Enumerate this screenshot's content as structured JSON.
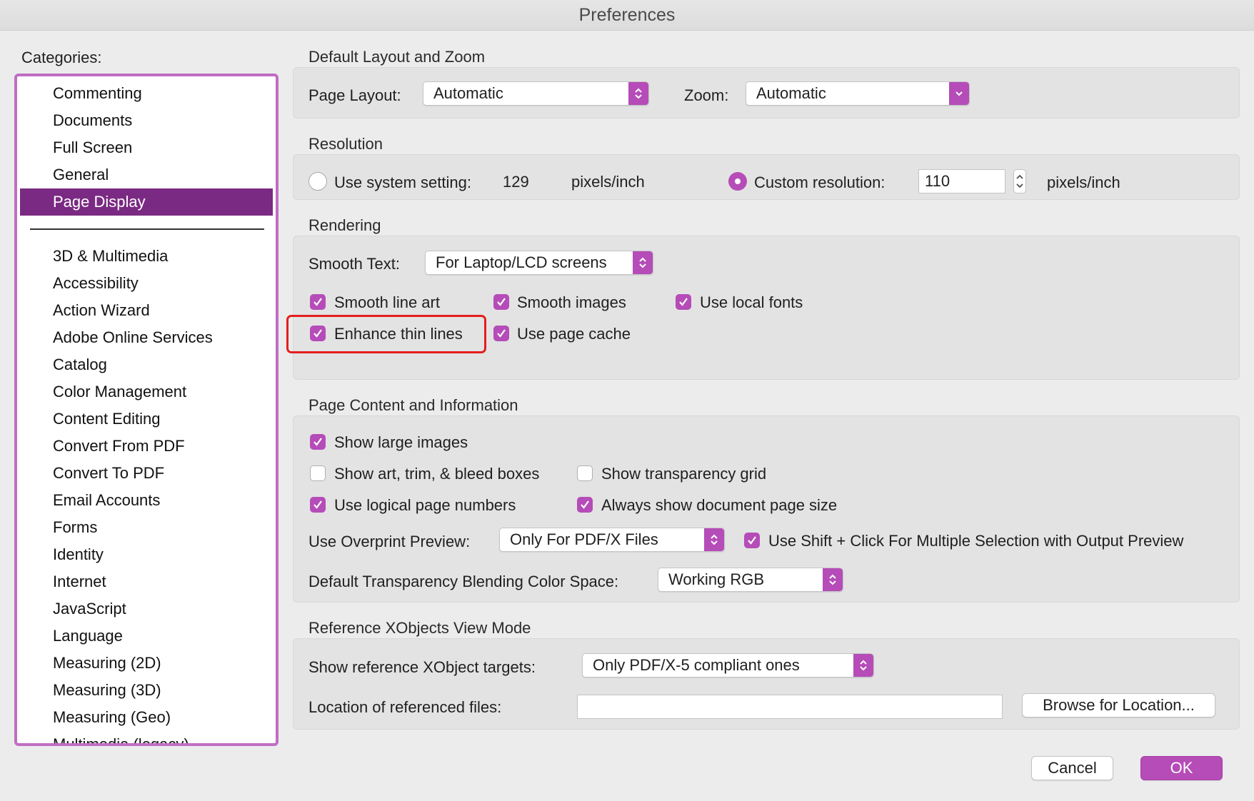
{
  "window": {
    "title": "Preferences"
  },
  "sidebar": {
    "label": "Categories:",
    "top_items": [
      "Commenting",
      "Documents",
      "Full Screen",
      "General",
      "Page Display"
    ],
    "selected": "Page Display",
    "items": [
      "3D & Multimedia",
      "Accessibility",
      "Action Wizard",
      "Adobe Online Services",
      "Catalog",
      "Color Management",
      "Content Editing",
      "Convert From PDF",
      "Convert To PDF",
      "Email Accounts",
      "Forms",
      "Identity",
      "Internet",
      "JavaScript",
      "Language",
      "Measuring (2D)",
      "Measuring (3D)",
      "Measuring (Geo)",
      "Multimedia (legacy)"
    ]
  },
  "layout_zoom": {
    "heading": "Default Layout and Zoom",
    "page_layout_label": "Page Layout:",
    "page_layout_value": "Automatic",
    "zoom_label": "Zoom:",
    "zoom_value": "Automatic"
  },
  "resolution": {
    "heading": "Resolution",
    "system_label": "Use system setting:",
    "system_value": "129",
    "unit": "pixels/inch",
    "custom_label": "Custom resolution:",
    "custom_value": "110",
    "system_selected": false,
    "custom_selected": true
  },
  "rendering": {
    "heading": "Rendering",
    "smooth_text_label": "Smooth Text:",
    "smooth_text_value": "For Laptop/LCD screens",
    "smooth_line_art": "Smooth line art",
    "smooth_images": "Smooth images",
    "use_local_fonts": "Use local fonts",
    "enhance_thin_lines": "Enhance thin lines",
    "use_page_cache": "Use page cache"
  },
  "page_content": {
    "heading": "Page Content and Information",
    "show_large_images": "Show large images",
    "show_art_boxes": "Show art, trim, & bleed boxes",
    "show_transparency_grid": "Show transparency grid",
    "use_logical_page_numbers": "Use logical page numbers",
    "always_show_page_size": "Always show document page size",
    "overprint_label": "Use Overprint Preview:",
    "overprint_value": "Only For PDF/X Files",
    "shift_click": "Use Shift + Click For Multiple Selection with Output Preview",
    "blending_label": "Default Transparency Blending Color Space:",
    "blending_value": "Working RGB"
  },
  "xobjects": {
    "heading": "Reference XObjects View Mode",
    "targets_label": "Show reference XObject targets:",
    "targets_value": "Only PDF/X-5 compliant ones",
    "location_label": "Location of referenced files:",
    "location_value": "",
    "browse_label": "Browse for Location..."
  },
  "footer": {
    "cancel_label": "Cancel",
    "ok_label": "OK"
  },
  "colors": {
    "accent": "#b54cb8",
    "selection": "#7a2a82",
    "highlight": "#e41e1e"
  }
}
